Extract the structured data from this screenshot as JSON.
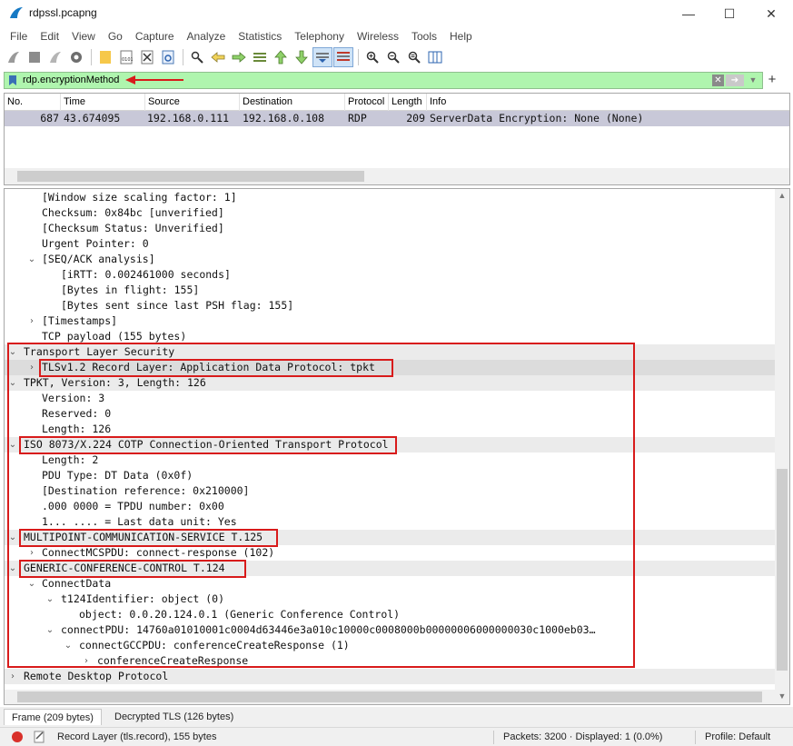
{
  "window": {
    "title": "rdpssl.pcapng"
  },
  "menu": [
    "File",
    "Edit",
    "View",
    "Go",
    "Capture",
    "Analyze",
    "Statistics",
    "Telephony",
    "Wireless",
    "Tools",
    "Help"
  ],
  "filter": {
    "value": "rdp.encryptionMethod"
  },
  "packet_list": {
    "columns": [
      "No.",
      "Time",
      "Source",
      "Destination",
      "Protocol",
      "Length",
      "Info"
    ],
    "rows": [
      {
        "no": "687",
        "time": "43.674095",
        "source": "192.168.0.111",
        "destination": "192.168.0.108",
        "protocol": "RDP",
        "length": "209",
        "info": "ServerData Encryption: None (None)"
      }
    ]
  },
  "details": [
    {
      "text": "[Window size scaling factor: 1]"
    },
    {
      "text": "Checksum: 0x84bc [unverified]"
    },
    {
      "text": "[Checksum Status: Unverified]"
    },
    {
      "text": "Urgent Pointer: 0"
    },
    {
      "text": "[SEQ/ACK analysis]"
    },
    {
      "text": "[iRTT: 0.002461000 seconds]"
    },
    {
      "text": "[Bytes in flight: 155]"
    },
    {
      "text": "[Bytes sent since last PSH flag: 155]"
    },
    {
      "text": "[Timestamps]"
    },
    {
      "text": "TCP payload (155 bytes)"
    },
    {
      "text": "Transport Layer Security"
    },
    {
      "text": "TLSv1.2 Record Layer: Application Data Protocol: tpkt"
    },
    {
      "text": "TPKT, Version: 3, Length: 126"
    },
    {
      "text": "Version: 3"
    },
    {
      "text": "Reserved: 0"
    },
    {
      "text": "Length: 126"
    },
    {
      "text": "ISO 8073/X.224 COTP Connection-Oriented Transport Protocol"
    },
    {
      "text": "Length: 2"
    },
    {
      "text": "PDU Type: DT Data (0x0f)"
    },
    {
      "text": "[Destination reference: 0x210000]"
    },
    {
      "text": ".000 0000 = TPDU number: 0x00"
    },
    {
      "text": "1... .... = Last data unit: Yes"
    },
    {
      "text": "MULTIPOINT-COMMUNICATION-SERVICE T.125"
    },
    {
      "text": "ConnectMCSPDU: connect-response (102)"
    },
    {
      "text": "GENERIC-CONFERENCE-CONTROL T.124"
    },
    {
      "text": "ConnectData"
    },
    {
      "text": "t124Identifier: object (0)"
    },
    {
      "text": "object: 0.0.20.124.0.1 (Generic Conference Control)"
    },
    {
      "text": "connectPDU: 14760a01010001c0004d63446e3a010c10000c0008000b00000006000000030c1000eb03…"
    },
    {
      "text": "connectGCCPDU: conferenceCreateResponse (1)"
    },
    {
      "text": "conferenceCreateResponse"
    },
    {
      "text": "Remote Desktop Protocol"
    }
  ],
  "bottom_tabs": [
    "Frame (209 bytes)",
    "Decrypted TLS (126 bytes)"
  ],
  "status": {
    "field": "Record Layer (tls.record), 155 bytes",
    "packets": "Packets: 3200 · Displayed: 1 (0.0%)",
    "profile": "Profile: Default"
  },
  "colors": {
    "filter_valid": "#aff5ae",
    "selected_row": "#c8c8d8",
    "highlight_box": "#d81b1b"
  }
}
